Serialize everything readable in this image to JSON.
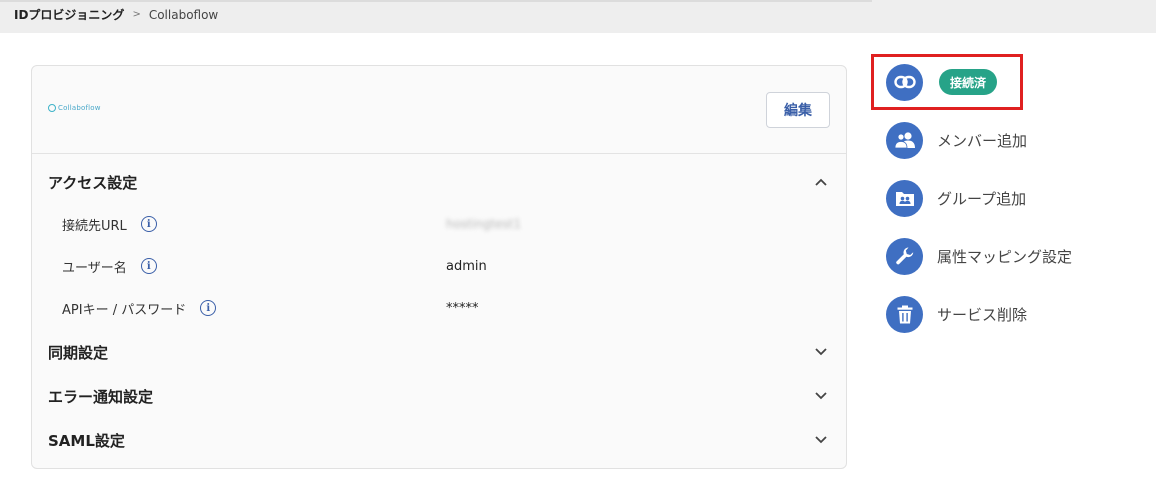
{
  "breadcrumb": {
    "root": "IDプロビジョニング",
    "separator": ">",
    "current": "Collaboflow"
  },
  "card": {
    "logo_text": "Collaboflow",
    "edit_label": "編集"
  },
  "sections": {
    "access": {
      "title": "アクセス設定",
      "expanded": true,
      "fields": [
        {
          "label": "接続先URL",
          "value": "hostingtest1",
          "blurred": true
        },
        {
          "label": "ユーザー名",
          "value": "admin",
          "blurred": false
        },
        {
          "label": "APIキー / パスワード",
          "value": "*****",
          "blurred": false
        }
      ]
    },
    "sync": {
      "title": "同期設定",
      "expanded": false
    },
    "error_notify": {
      "title": "エラー通知設定",
      "expanded": false
    },
    "saml": {
      "title": "SAML設定",
      "expanded": false
    }
  },
  "side_menu": {
    "connection_status": "接続済",
    "items": [
      {
        "label": "メンバー追加",
        "icon": "add-member-icon"
      },
      {
        "label": "グループ追加",
        "icon": "add-group-icon"
      },
      {
        "label": "属性マッピング設定",
        "icon": "wrench-icon"
      },
      {
        "label": "サービス削除",
        "icon": "trash-icon"
      }
    ]
  },
  "colors": {
    "accent_blue": "#3f6fc2",
    "badge_green": "#27a388",
    "highlight_red": "#e02020"
  }
}
